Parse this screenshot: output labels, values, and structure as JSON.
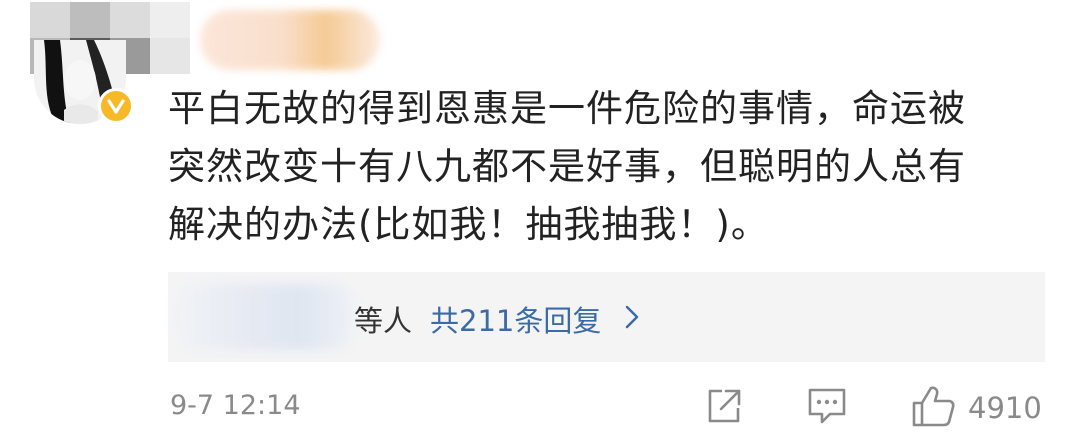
{
  "comment": {
    "lines": [
      "平白无故的得到恩惠是一件危险的事情，命运被",
      "突然改变十有八九都不是好事，但聪明的人总有",
      "解决的办法(比如我！抽我抽我！)。"
    ]
  },
  "replies": {
    "people_suffix": "等人",
    "count_label": "共211条回复"
  },
  "footer": {
    "timestamp": "9-7 12:14",
    "like_count": "4910"
  },
  "icons": {
    "verified": "verified-badge-icon",
    "share": "share-icon",
    "comment": "comment-icon",
    "like": "thumbs-up-icon",
    "chevron": "chevron-right-icon"
  },
  "colors": {
    "text": "#222222",
    "link": "#3b6aa8",
    "muted": "#8a8a8a",
    "reply_bg": "#f4f4f4",
    "verified": "#f7b928"
  }
}
